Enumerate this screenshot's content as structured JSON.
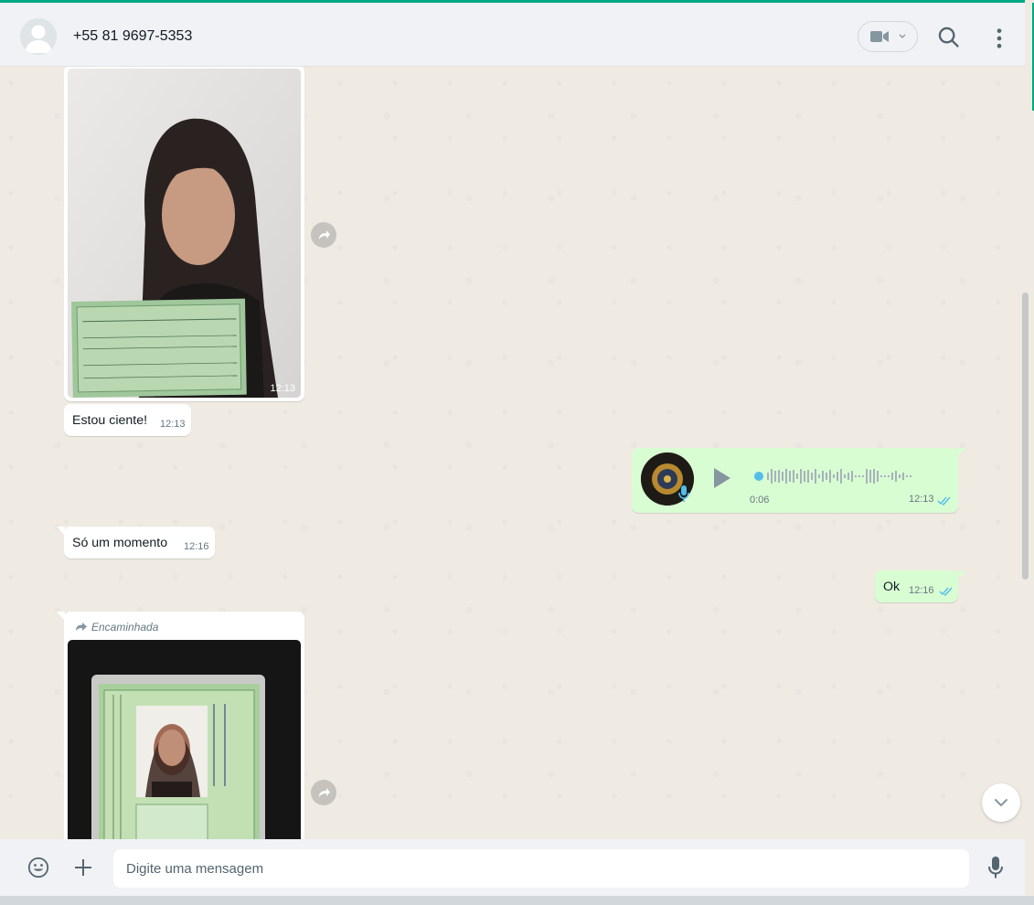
{
  "header": {
    "contact_name": "+55 81 9697-5353",
    "icons": [
      "default-avatar-icon",
      "video-call-icon",
      "chevron-down-icon",
      "search-icon",
      "menu-icon"
    ]
  },
  "messages": [
    {
      "direction": "in",
      "type": "image",
      "time": "12:13"
    },
    {
      "direction": "in",
      "type": "text",
      "text": "Estou ciente!",
      "time": "12:13"
    },
    {
      "direction": "out",
      "type": "audio",
      "duration": "0:06",
      "time": "12:13",
      "status": "read"
    },
    {
      "direction": "in",
      "type": "text",
      "text": "Só um momento",
      "time": "12:16"
    },
    {
      "direction": "out",
      "type": "text",
      "text": "Ok",
      "time": "12:16",
      "status": "read"
    },
    {
      "direction": "in",
      "type": "image",
      "forwarded_label": "Encaminhada"
    }
  ],
  "composer": {
    "placeholder": "Digite uma mensagem"
  },
  "colors": {
    "accent": "#00a884",
    "outgoing_bubble": "#d9fdd3",
    "incoming_bubble": "#ffffff",
    "chat_background": "#efeae2",
    "read_ticks": "#53bdeb"
  }
}
